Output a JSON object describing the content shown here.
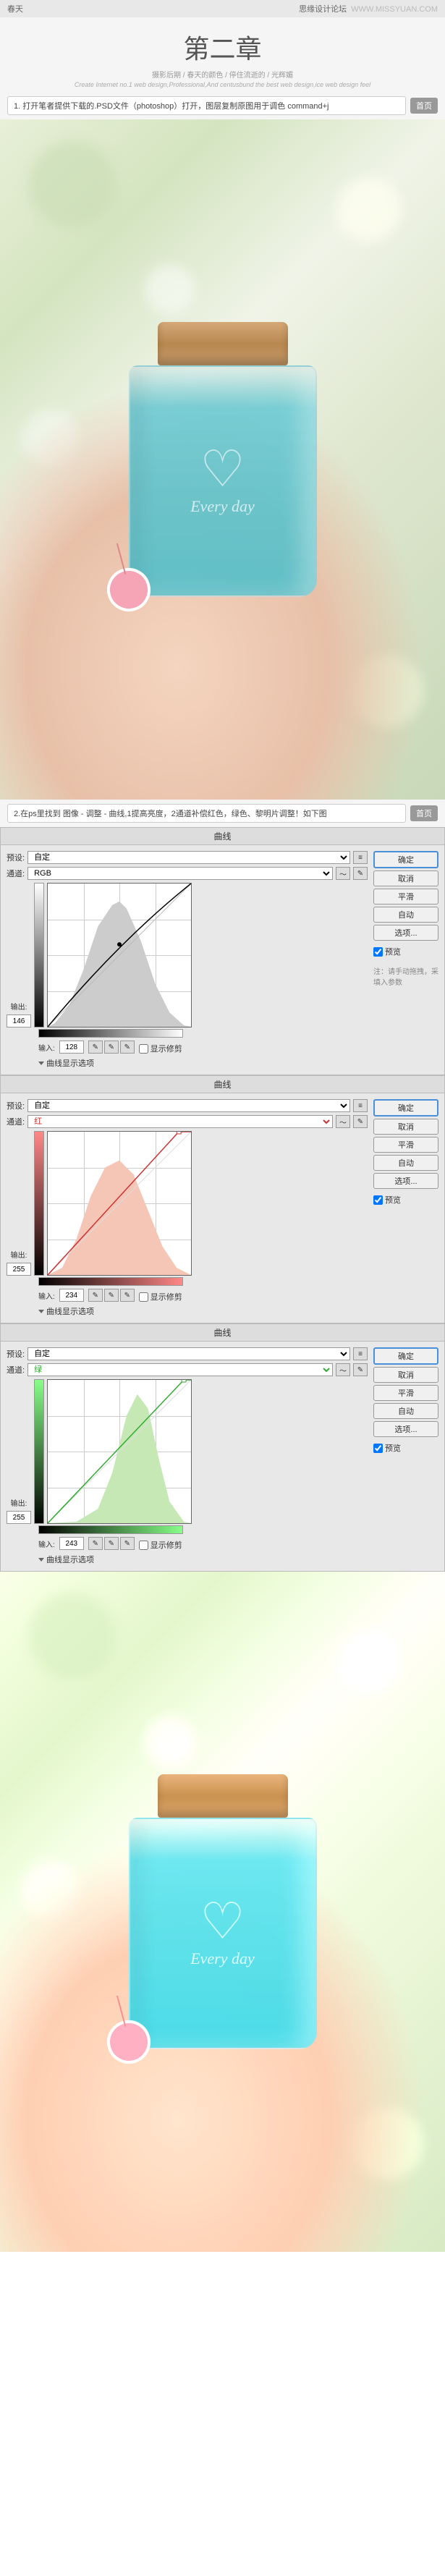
{
  "header": {
    "left": "春天",
    "right_brand": "思缘设计论坛",
    "right_url": "WWW.MISSYUAN.COM"
  },
  "title": {
    "chapter": "第二章",
    "breadcrumb": "摄影后期 / 春天的颜色 / 停住流逝的 / 光辉媚",
    "tagline_en": "Create Internet no.1 web design,Professional,And centusbund the best web design,ice web design feel"
  },
  "steps": {
    "s1": "1. 打开笔者提供下载的.PSD文件（photoshop）打开，图层复制原图用于调色 command+j",
    "s2": "2.在ps里找到 图像 - 调整 - 曲线,1提高亮度，2通道补偿红色，绿色、黎明片调整！如下图",
    "page_btn": "首页"
  },
  "bottle": {
    "text": "Every day"
  },
  "curves_common": {
    "title": "曲线",
    "preset_label": "预设:",
    "preset_value": "自定",
    "channel_label": "通道:",
    "output_label": "输出:",
    "input_label": "输入:",
    "show_clip": "显示修剪",
    "options_toggle": "曲线显示选项",
    "btn_ok": "确定",
    "btn_cancel": "取消",
    "btn_smooth": "平滑",
    "btn_auto": "自动",
    "btn_options": "选项...",
    "chk_preview": "预览",
    "note": "注：请手动拖拽，采填入参数"
  },
  "curve_rgb": {
    "channel": "RGB",
    "output": "146",
    "input": "128"
  },
  "curve_red": {
    "channel": "红",
    "output": "255",
    "input": "234"
  },
  "curve_green": {
    "channel": "绿",
    "output": "255",
    "input": "243"
  },
  "chart_data": [
    {
      "type": "line",
      "title": "曲线 RGB",
      "xlabel": "输入",
      "ylabel": "输出",
      "xlim": [
        0,
        255
      ],
      "ylim": [
        0,
        255
      ],
      "series": [
        {
          "name": "RGB",
          "values": [
            [
              0,
              0
            ],
            [
              128,
              146
            ],
            [
              255,
              255
            ]
          ]
        }
      ]
    },
    {
      "type": "line",
      "title": "曲线 红",
      "xlabel": "输入",
      "ylabel": "输出",
      "xlim": [
        0,
        255
      ],
      "ylim": [
        0,
        255
      ],
      "series": [
        {
          "name": "红",
          "values": [
            [
              0,
              0
            ],
            [
              234,
              255
            ],
            [
              255,
              255
            ]
          ]
        }
      ]
    },
    {
      "type": "line",
      "title": "曲线 绿",
      "xlabel": "输入",
      "ylabel": "输出",
      "xlim": [
        0,
        255
      ],
      "ylim": [
        0,
        255
      ],
      "series": [
        {
          "name": "绿",
          "values": [
            [
              0,
              0
            ],
            [
              243,
              255
            ],
            [
              255,
              255
            ]
          ]
        }
      ]
    }
  ]
}
